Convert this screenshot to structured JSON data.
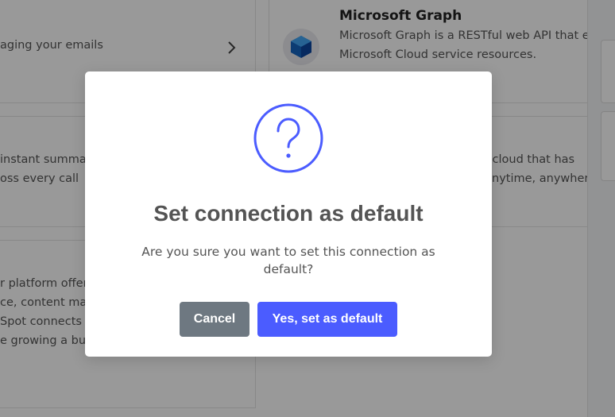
{
  "background": {
    "email_card": {
      "description_partial": "aging your emails"
    },
    "microsoft_graph": {
      "title": "Microsoft Graph",
      "line1": "Microsoft Graph is a RESTful web API that e",
      "line2": "Microsoft Cloud service resources."
    },
    "summary_card": {
      "line1": "instant summa",
      "line2": "oss every call"
    },
    "cloud_card": {
      "line1": "e cloud that has",
      "line2": "nytime, anywhere"
    },
    "platform_card": {
      "line1": "r platform offers",
      "line2": "ce, content ma",
      "line3": "Spot connects",
      "line4": "e growing a bus"
    }
  },
  "modal": {
    "icon": "question-mark-icon",
    "title": "Set connection as default",
    "message": "Are you sure you want to set this connection as default?",
    "cancel_label": "Cancel",
    "confirm_label": "Yes, set as default"
  },
  "colors": {
    "accent": "#4b5cff",
    "icon": "#4b5cff",
    "cancel": "#6e7881",
    "title": "#545454"
  }
}
